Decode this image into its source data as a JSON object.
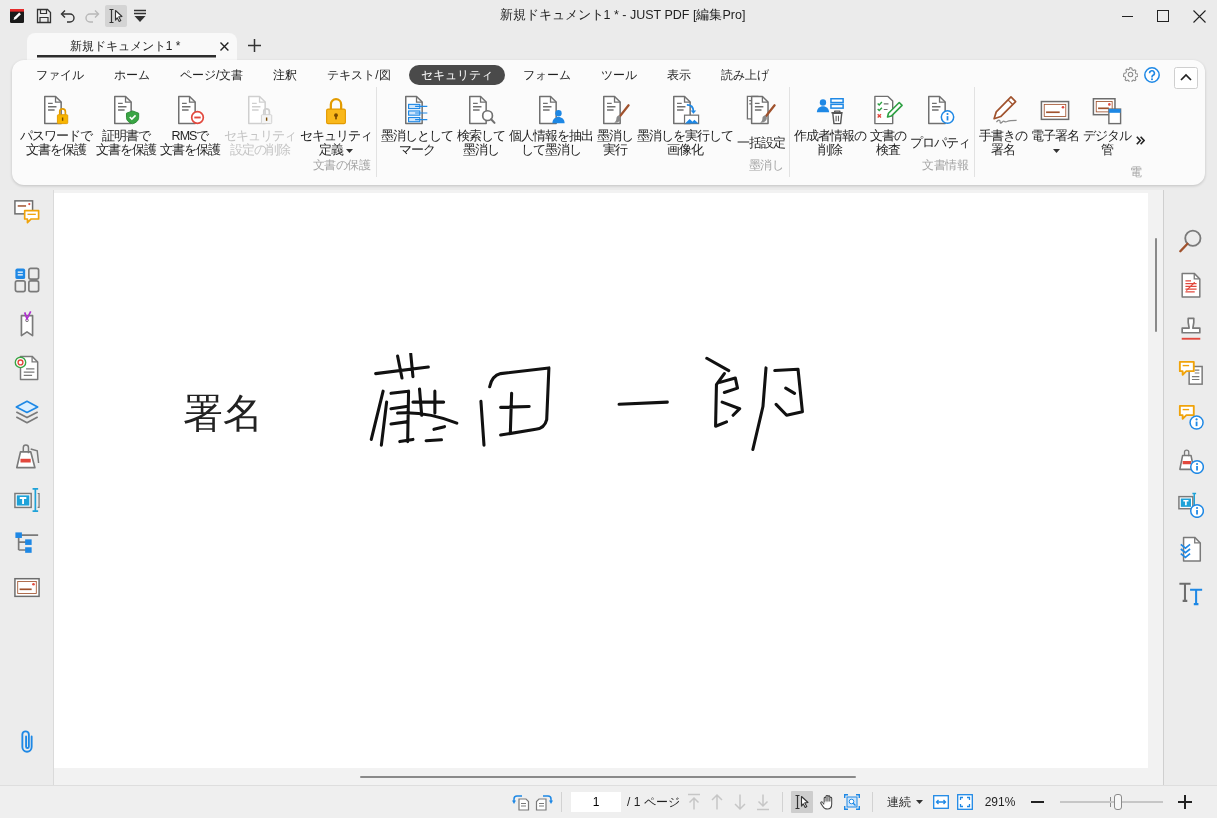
{
  "window": {
    "title": "新規ドキュメント1 * - JUST PDF [編集Pro]"
  },
  "quick_access": [
    {
      "kind": "save",
      "disabled": false,
      "on": false
    },
    {
      "kind": "undo",
      "disabled": false,
      "on": false
    },
    {
      "kind": "redo",
      "disabled": true,
      "on": false
    },
    {
      "kind": "select",
      "disabled": false,
      "on": true
    },
    {
      "kind": "customize",
      "disabled": false,
      "on": false
    }
  ],
  "document_tabs": [
    {
      "label": "新規ドキュメント1 *",
      "selected": true
    }
  ],
  "ribbon": {
    "tabs": [
      {
        "label": "ファイル",
        "selected": false
      },
      {
        "label": "ホーム",
        "selected": false
      },
      {
        "label": "ページ/文書",
        "selected": false
      },
      {
        "label": "注釈",
        "selected": false
      },
      {
        "label": "テキスト/図",
        "selected": false
      },
      {
        "label": "セキュリティ",
        "selected": true
      },
      {
        "label": "フォーム",
        "selected": false
      },
      {
        "label": "ツール",
        "selected": false
      },
      {
        "label": "表示",
        "selected": false
      },
      {
        "label": "読み上げ",
        "selected": false
      }
    ],
    "groups": [
      {
        "label": "文書の保護",
        "buttons": [
          {
            "kind": "password",
            "lines": [
              "パスワードで",
              "文書を保護"
            ],
            "disabled": false,
            "dropdown": false
          },
          {
            "kind": "certificate",
            "lines": [
              "証明書で",
              "文書を保護"
            ],
            "disabled": false,
            "dropdown": false
          },
          {
            "kind": "rms",
            "lines": [
              "RMSで",
              "文書を保護"
            ],
            "disabled": false,
            "dropdown": false
          },
          {
            "kind": "remove_security",
            "lines": [
              "セキュリティ",
              "設定の削除"
            ],
            "disabled": true,
            "dropdown": false
          },
          {
            "kind": "security_policy",
            "lines": [
              "セキュリティ",
              "定義"
            ],
            "disabled": false,
            "dropdown": true
          }
        ]
      },
      {
        "label": "墨消し",
        "buttons": [
          {
            "kind": "mark_redaction",
            "lines": [
              "墨消しとして",
              "マーク"
            ],
            "disabled": false,
            "dropdown": false
          },
          {
            "kind": "search_redact",
            "lines": [
              "検索して",
              "墨消し"
            ],
            "disabled": false,
            "dropdown": false
          },
          {
            "kind": "extract_redact",
            "lines": [
              "個人情報を抽出",
              "して墨消し"
            ],
            "disabled": false,
            "dropdown": false
          },
          {
            "kind": "apply_redaction",
            "lines": [
              "墨消し",
              "実行"
            ],
            "disabled": false,
            "dropdown": false
          },
          {
            "kind": "redact_rasterize",
            "lines": [
              "墨消しを実行して",
              "画像化"
            ],
            "disabled": false,
            "dropdown": false
          },
          {
            "kind": "bulk_settings",
            "lines": [
              "一括設定"
            ],
            "disabled": false,
            "dropdown": false
          }
        ]
      },
      {
        "label": "文書情報",
        "buttons": [
          {
            "kind": "remove_author",
            "lines": [
              "作成者情報の",
              "削除"
            ],
            "disabled": false,
            "dropdown": false
          },
          {
            "kind": "inspect",
            "lines": [
              "文書の",
              "検査"
            ],
            "disabled": false,
            "dropdown": false
          },
          {
            "kind": "properties",
            "lines": [
              "プロパティ"
            ],
            "disabled": false,
            "dropdown": false
          }
        ]
      },
      {
        "label": "電",
        "buttons": [
          {
            "kind": "handwritten_signature",
            "lines": [
              "手書きの",
              "署名"
            ],
            "disabled": false,
            "dropdown": false
          },
          {
            "kind": "digital_signature",
            "lines": [
              "電子署名"
            ],
            "disabled": false,
            "dropdown": true
          },
          {
            "kind": "digital_id",
            "lines": [
              "デジタル",
              "管"
            ],
            "disabled": false,
            "dropdown": false
          }
        ]
      }
    ]
  },
  "page": {
    "label": "署名"
  },
  "status_bar": {
    "page_number": "1",
    "page_count": "/ 1 ページ",
    "navigation": [
      {
        "kind": "first",
        "disabled": true
      },
      {
        "kind": "up",
        "disabled": true
      },
      {
        "kind": "down",
        "disabled": true
      },
      {
        "kind": "last",
        "disabled": true
      }
    ],
    "tools": [
      {
        "kind": "select",
        "selected": true
      },
      {
        "kind": "hand",
        "selected": false
      },
      {
        "kind": "marquee",
        "selected": false
      }
    ],
    "layout": "連続",
    "zoom": "291%",
    "zoom_slider": {
      "level": 0.56
    }
  }
}
